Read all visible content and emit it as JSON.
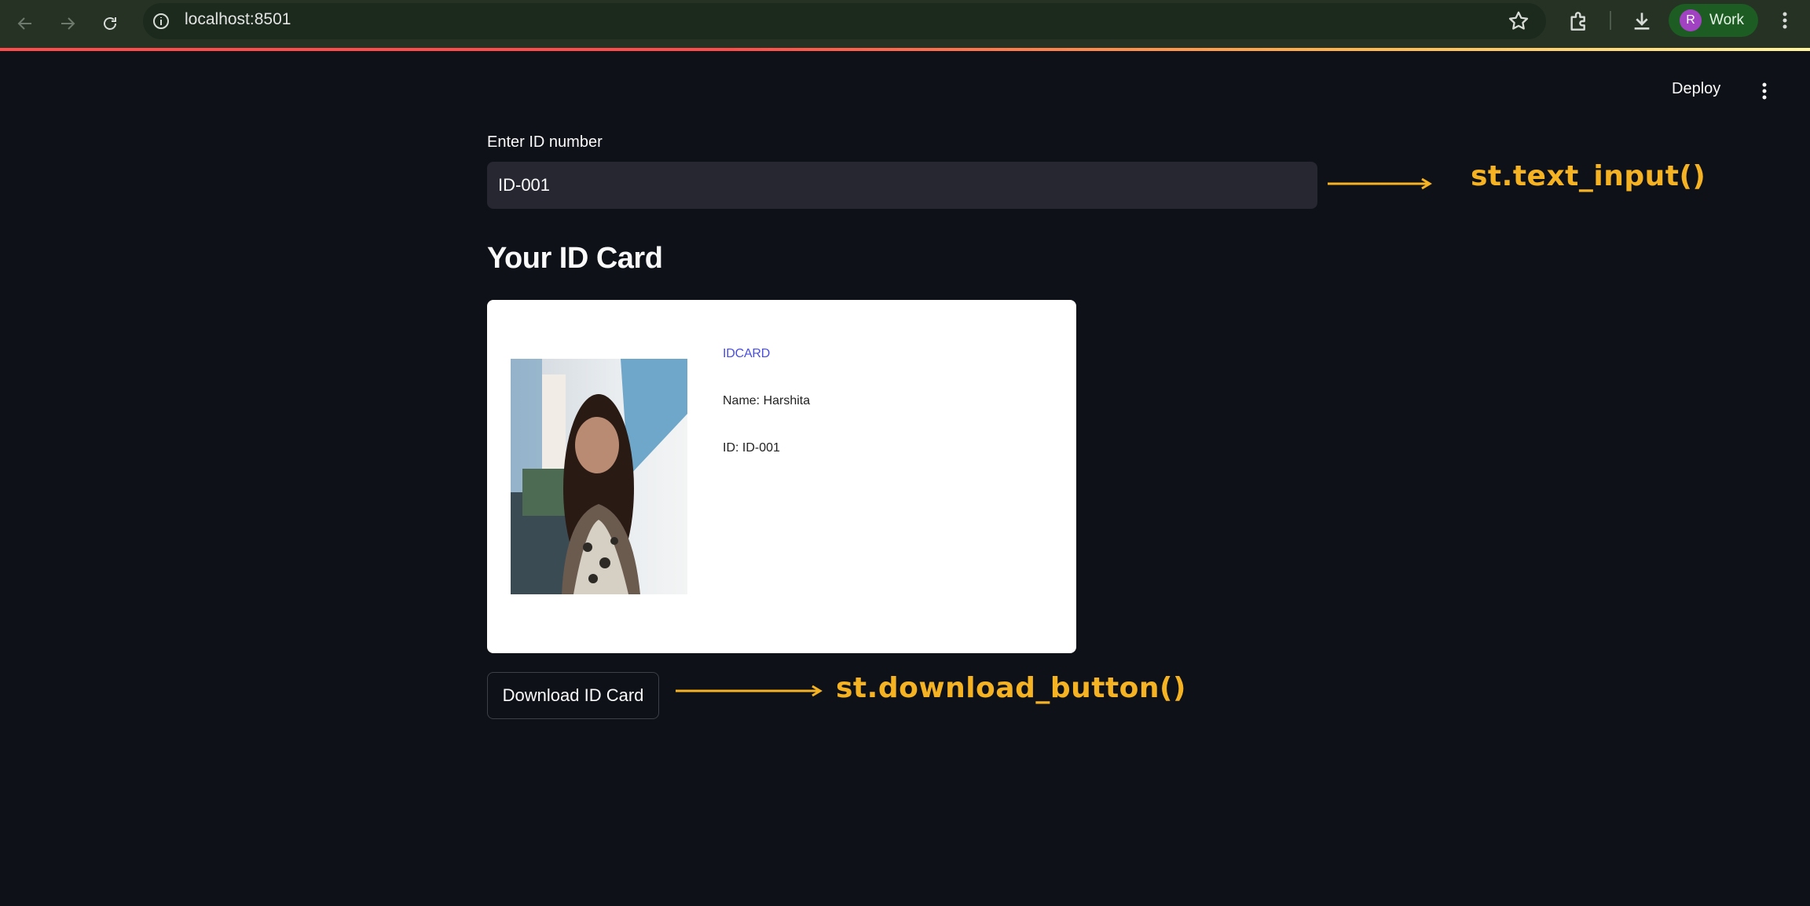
{
  "browser": {
    "url": "localhost:8501",
    "profile_initial": "R",
    "profile_label": "Work",
    "accent_line_colors": [
      "#ff4b4b",
      "#ffb74d",
      "#fff59d"
    ]
  },
  "header": {
    "deploy_label": "Deploy"
  },
  "form": {
    "input_label": "Enter ID number",
    "input_value": "ID-001"
  },
  "section": {
    "heading": "Your ID Card"
  },
  "card": {
    "title": "IDCARD",
    "name_line": "Name: Harshita",
    "id_line": "ID: ID-001"
  },
  "actions": {
    "download_label": "Download ID Card"
  },
  "annotations": {
    "text_input": "st.text_input()",
    "download_button": "st.download_button()",
    "color": "#f5b324"
  }
}
